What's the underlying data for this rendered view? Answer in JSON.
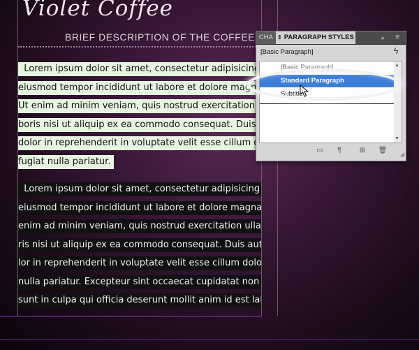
{
  "document": {
    "title": "Violet Coffee",
    "subtitle": "BRIEF DESCRIPTION OF THE COFFEE SHOP",
    "paragraph1_lines": [
      "  Lorem ipsum dolor sit amet, consectetur adipisicing elit, sed do",
      "eiusmod tempor incididunt ut labore et dolore magna aliqua.",
      "Ut enim ad minim veniam, quis nostrud exercitation ullamco la-",
      "boris nisi ut aliquip ex ea commodo consequat. Duis aute irure",
      "dolor in reprehenderit in voluptate velit esse cillum dolore eu",
      "fugiat nulla pariatur. "
    ],
    "paragraph2_lines": [
      "  Lorem ipsum dolor sit amet, consectetur adipisicing elit, sed do",
      "eiusmod tempor incididunt ut labore et dolore magna aliqua. Ut",
      "enim ad minim veniam, quis nostrud exercitation ullamco labo-",
      "ris nisi ut aliquip ex ea commodo consequat. Duis aute irure do-",
      "lor in reprehenderit in voluptate velit esse cillum dolore eu fugiat",
      "nulla pariatur. Excepteur sint occaecat cupidatat non proident,",
      "sunt in culpa qui officia deserunt mollit anim id est laborum. "
    ]
  },
  "panel": {
    "tab_character": "CHA",
    "tab_paragraph_styles": "PARAGRAPH STYLES",
    "expand_icon": "»",
    "menu_icon": "≡",
    "current_style": "[Basic Paragraph]",
    "items": [
      "[Basic Paragraph]",
      "Standard Paragraph",
      "Subtitle"
    ],
    "selected_index": 1
  },
  "colors": {
    "guide": "#8a3fbf",
    "selection": "#3d7fd8",
    "paragraph1_highlight": "#e6f5df"
  }
}
